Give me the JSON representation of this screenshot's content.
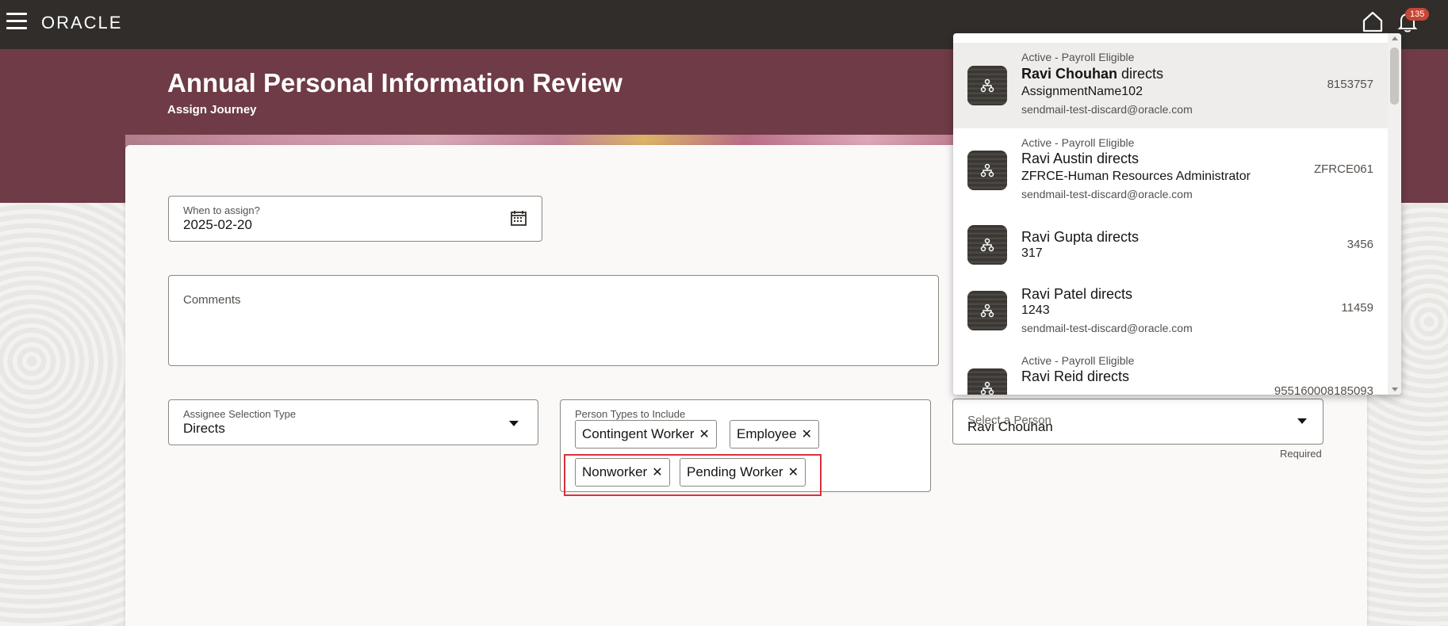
{
  "header": {
    "logo": "ORACLE",
    "notification_count": "135"
  },
  "banner": {
    "title": "Annual Personal Information Review",
    "subtitle": "Assign Journey"
  },
  "form": {
    "when_label": "When to assign?",
    "when_value": "2025-02-20",
    "comments_label": "Comments",
    "assignee_label": "Assignee Selection Type",
    "assignee_value": "Directs",
    "ptypes_label": "Person Types to Include",
    "ptypes": [
      "Contingent Worker",
      "Employee",
      "Nonworker",
      "Pending Worker"
    ],
    "person_placeholder": "Select a Person",
    "person_value": "Ravi Chouhan",
    "required": "Required"
  },
  "dropdown": {
    "options": [
      {
        "status": "Active - Payroll Eligible",
        "name_bold": "Ravi Chouhan",
        "name_rest": " directs",
        "line2": "AssignmentName102",
        "email": "sendmail-test-discard@oracle.com",
        "id": "8153757"
      },
      {
        "status": "Active - Payroll Eligible",
        "name_bold": "",
        "name_rest": "Ravi Austin directs",
        "line2": "ZFRCE-Human Resources Administrator",
        "email": "sendmail-test-discard@oracle.com",
        "id": "ZFRCE061"
      },
      {
        "status": "",
        "name_bold": "",
        "name_rest": "Ravi Gupta directs",
        "line2": "317",
        "email": "",
        "id": "3456"
      },
      {
        "status": "",
        "name_bold": "",
        "name_rest": "Ravi Patel directs",
        "line2": "1243",
        "email": "sendmail-test-discard@oracle.com",
        "id": "11459"
      },
      {
        "status": "Active - Payroll Eligible",
        "name_bold": "",
        "name_rest": "Ravi Reid directs",
        "line2": "",
        "email": "",
        "id": "955160008185093"
      }
    ]
  },
  "icons": {
    "menu": "hamburger-icon",
    "home": "home-icon",
    "notifications": "bell-icon",
    "calendar": "calendar-icon",
    "remove": "close-icon",
    "dropdown": "chevron-down-icon",
    "person": "org-chart-icon"
  },
  "colors": {
    "header_bg": "#312d2a",
    "banner_bg": "#6e3b47",
    "badge": "#c74634",
    "highlight": "#d9313b"
  }
}
